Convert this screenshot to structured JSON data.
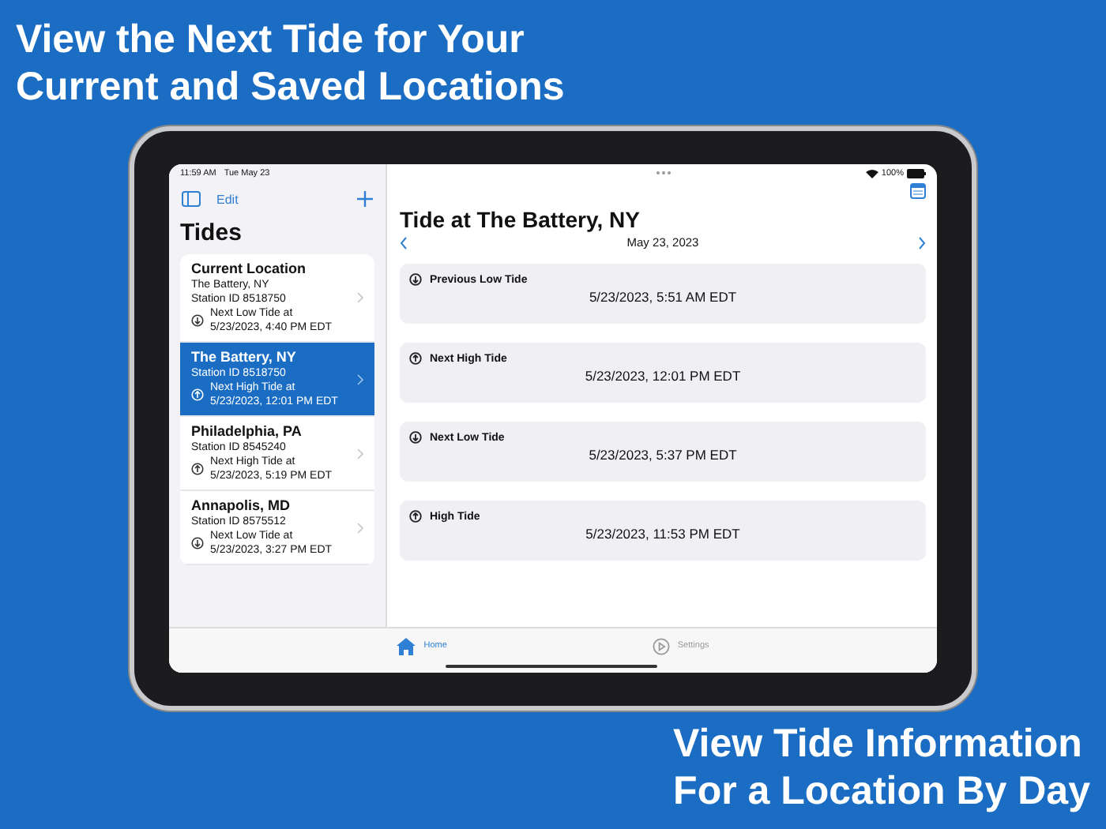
{
  "headline": [
    "View the Next Tide for Your",
    "Current and Saved Locations"
  ],
  "status_bar": {
    "time": "11:59 AM",
    "date": "Tue May 23",
    "battery": "100%"
  },
  "sidebar": {
    "edit": "Edit",
    "title": "Tides",
    "items": [
      {
        "name": "Current Location",
        "subtitle": "The Battery, NY",
        "station": "Station ID 8518750",
        "kind": "low",
        "next_label": "Next Low Tide at",
        "next_time": "5/23/2023, 4:40 PM EDT",
        "selected": false
      },
      {
        "name": "The Battery, NY",
        "station": "Station ID 8518750",
        "kind": "high",
        "next_label": "Next High Tide at",
        "next_time": "5/23/2023, 12:01 PM EDT",
        "selected": true
      },
      {
        "name": "Philadelphia, PA",
        "station": "Station ID 8545240",
        "kind": "high",
        "next_label": "Next High Tide at",
        "next_time": "5/23/2023, 5:19 PM EDT",
        "selected": false
      },
      {
        "name": "Annapolis, MD",
        "station": "Station ID 8575512",
        "kind": "low",
        "next_label": "Next Low Tide at",
        "next_time": "5/23/2023, 3:27 PM EDT",
        "selected": false
      }
    ]
  },
  "detail": {
    "title": "Tide at The Battery, NY",
    "date": "May 23, 2023",
    "tides": [
      {
        "kind": "low",
        "label": "Previous Low Tide",
        "time": "5/23/2023, 5:51 AM EDT"
      },
      {
        "kind": "high",
        "label": "Next High Tide",
        "time": "5/23/2023, 12:01 PM EDT"
      },
      {
        "kind": "low",
        "label": "Next Low Tide",
        "time": "5/23/2023, 5:37 PM EDT"
      },
      {
        "kind": "high",
        "label": "High Tide",
        "time": "5/23/2023, 11:53 PM EDT"
      }
    ]
  },
  "tab_bar": [
    {
      "kind": "home",
      "label": "Home",
      "selected": true
    },
    {
      "kind": "settings",
      "label": "Settings",
      "selected": false
    }
  ],
  "caption": [
    "View Tide Information",
    "For a Location By Day"
  ]
}
